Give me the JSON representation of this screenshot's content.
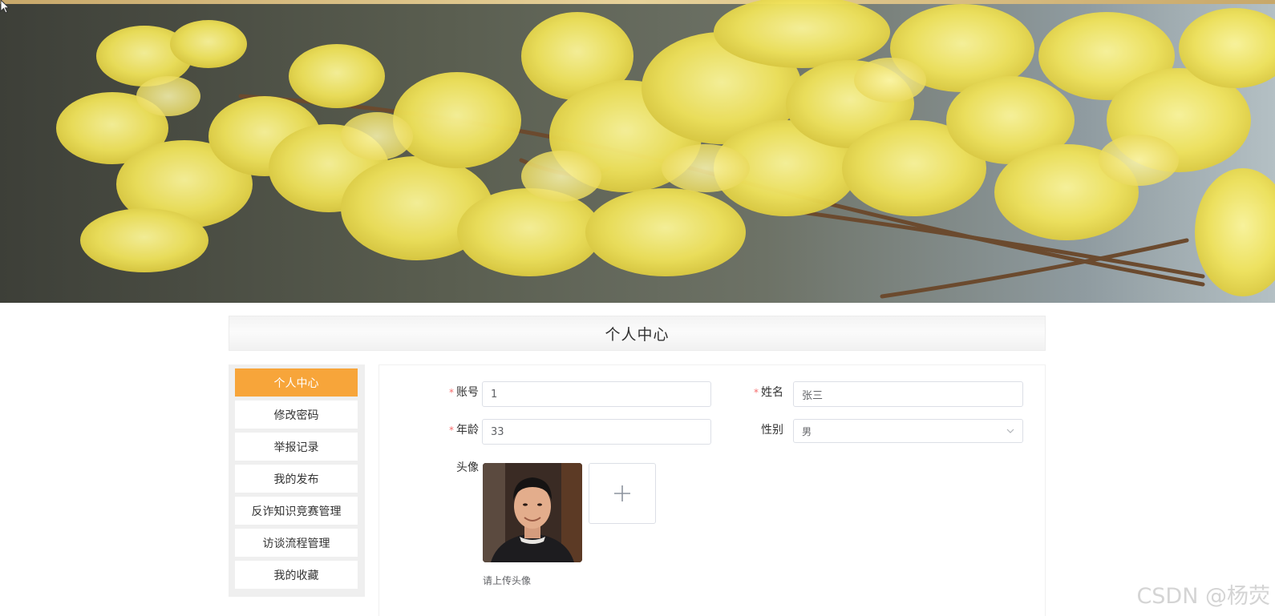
{
  "page": {
    "title": "个人中心"
  },
  "sidebar": {
    "items": [
      {
        "label": "个人中心",
        "active": true
      },
      {
        "label": "修改密码"
      },
      {
        "label": "举报记录"
      },
      {
        "label": "我的发布"
      },
      {
        "label": "反诈知识竞赛管理"
      },
      {
        "label": "访谈流程管理"
      },
      {
        "label": "我的收藏"
      }
    ]
  },
  "form": {
    "account": {
      "label": "账号",
      "value": "1",
      "required": true
    },
    "name": {
      "label": "姓名",
      "value": "张三",
      "required": true
    },
    "age": {
      "label": "年龄",
      "value": "33",
      "required": true
    },
    "gender": {
      "label": "性别",
      "value": "男",
      "required": false
    },
    "avatar": {
      "label": "头像",
      "hint": "请上传头像"
    }
  },
  "icons": {
    "upload": "plus-icon",
    "select": "chevron-down-icon",
    "cursor": "mouse-pointer-icon"
  },
  "colors": {
    "accent": "#f7a53a",
    "required": "#f56c6c"
  },
  "watermark": "CSDN @杨荧"
}
